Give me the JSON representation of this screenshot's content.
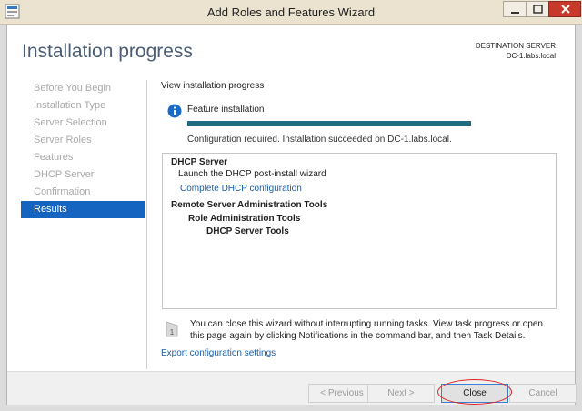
{
  "window": {
    "title": "Add Roles and Features Wizard"
  },
  "header": {
    "page_title": "Installation progress",
    "destination_label": "DESTINATION SERVER",
    "destination_server": "DC-1.labs.local"
  },
  "nav": {
    "items": [
      {
        "label": "Before You Begin",
        "active": false
      },
      {
        "label": "Installation Type",
        "active": false
      },
      {
        "label": "Server Selection",
        "active": false
      },
      {
        "label": "Server Roles",
        "active": false
      },
      {
        "label": "Features",
        "active": false
      },
      {
        "label": "DHCP Server",
        "active": false
      },
      {
        "label": "Confirmation",
        "active": false
      },
      {
        "label": "Results",
        "active": true
      }
    ]
  },
  "main": {
    "section_header": "View installation progress",
    "feature_label": "Feature installation",
    "progress": 1.0,
    "status": "Configuration required. Installation succeeded on DC-1.labs.local.",
    "results": {
      "dhcp_server": "DHCP Server",
      "launch_wizard": "Launch the DHCP post-install wizard",
      "complete_link": "Complete DHCP configuration",
      "rsat": "Remote Server Administration Tools",
      "role_admin": "Role Administration Tools",
      "dhcp_tools": "DHCP Server Tools"
    },
    "note_icon_number": "1",
    "note": "You can close this wizard without interrupting running tasks. View task progress or open this page again by clicking Notifications in the command bar, and then Task Details.",
    "export_link": "Export configuration settings"
  },
  "buttons": {
    "previous": "< Previous",
    "next": "Next >",
    "close": "Close",
    "cancel": "Cancel"
  },
  "colors": {
    "accent": "#1564c0",
    "progress": "#1f6b80",
    "link": "#1a5ea8",
    "annotation": "#e02020"
  },
  "icons": {
    "app": "wizard-app-icon",
    "info": "info-icon",
    "note": "flag-note-icon"
  }
}
